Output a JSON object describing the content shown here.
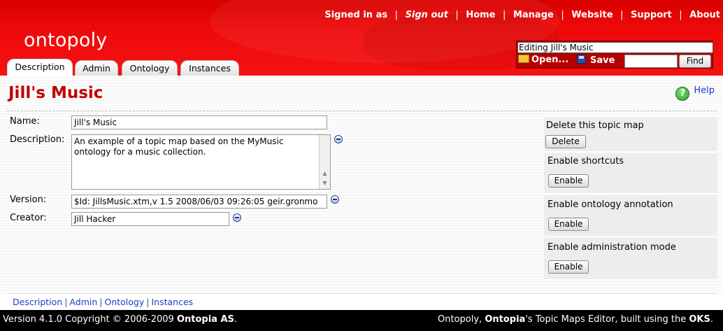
{
  "app": {
    "logo": "ontopoly"
  },
  "topnav": {
    "signed_in": "Signed in as",
    "sign_out": "Sign out",
    "home": "Home",
    "manage": "Manage",
    "website": "Website",
    "support": "Support",
    "about": "About",
    "separator": "|"
  },
  "editbox": {
    "title": "Editing Jill's Music",
    "open_label": "Open...",
    "save_label": "Save",
    "search_value": "",
    "find_label": "Find"
  },
  "tabs": [
    {
      "label": "Description",
      "active": true
    },
    {
      "label": "Admin",
      "active": false
    },
    {
      "label": "Ontology",
      "active": false
    },
    {
      "label": "Instances",
      "active": false
    }
  ],
  "page": {
    "title": "Jill's Music",
    "help_label": "Help",
    "help_icon": "?"
  },
  "fields": {
    "name": {
      "label": "Name:",
      "value": "Jill's Music"
    },
    "description": {
      "label": "Description:",
      "value": "An example of a topic map based on the MyMusic ontology for a music collection."
    },
    "version": {
      "label": "Version:",
      "value": "$Id: JillsMusic.xtm,v 1.5 2008/06/03 09:26:05 geir.gronmo"
    },
    "creator": {
      "label": "Creator:",
      "value": "Jill Hacker"
    }
  },
  "side": [
    {
      "title": "Delete this topic map",
      "button": "Delete"
    },
    {
      "title": "Enable shortcuts",
      "button": "Enable"
    },
    {
      "title": "Enable ontology annotation",
      "button": "Enable"
    },
    {
      "title": "Enable administration mode",
      "button": "Enable"
    }
  ],
  "bottom_nav": [
    "Description",
    "Admin",
    "Ontology",
    "Instances"
  ],
  "footer": {
    "left_prefix": "Version 4.1.0 Copyright © 2006-2009",
    "left_company": "Ontopia AS",
    "left_suffix": ".",
    "right_app": "Ontopoly",
    "right_comma": ", ",
    "right_brand": "Ontopia",
    "right_mid": "'s Topic Maps Editor, built using the ",
    "right_oks": "OKS",
    "right_end": "."
  },
  "colors": {
    "header_red": "#ee0a0a",
    "title_red": "#c00000",
    "link_blue": "#1a3ec4"
  }
}
